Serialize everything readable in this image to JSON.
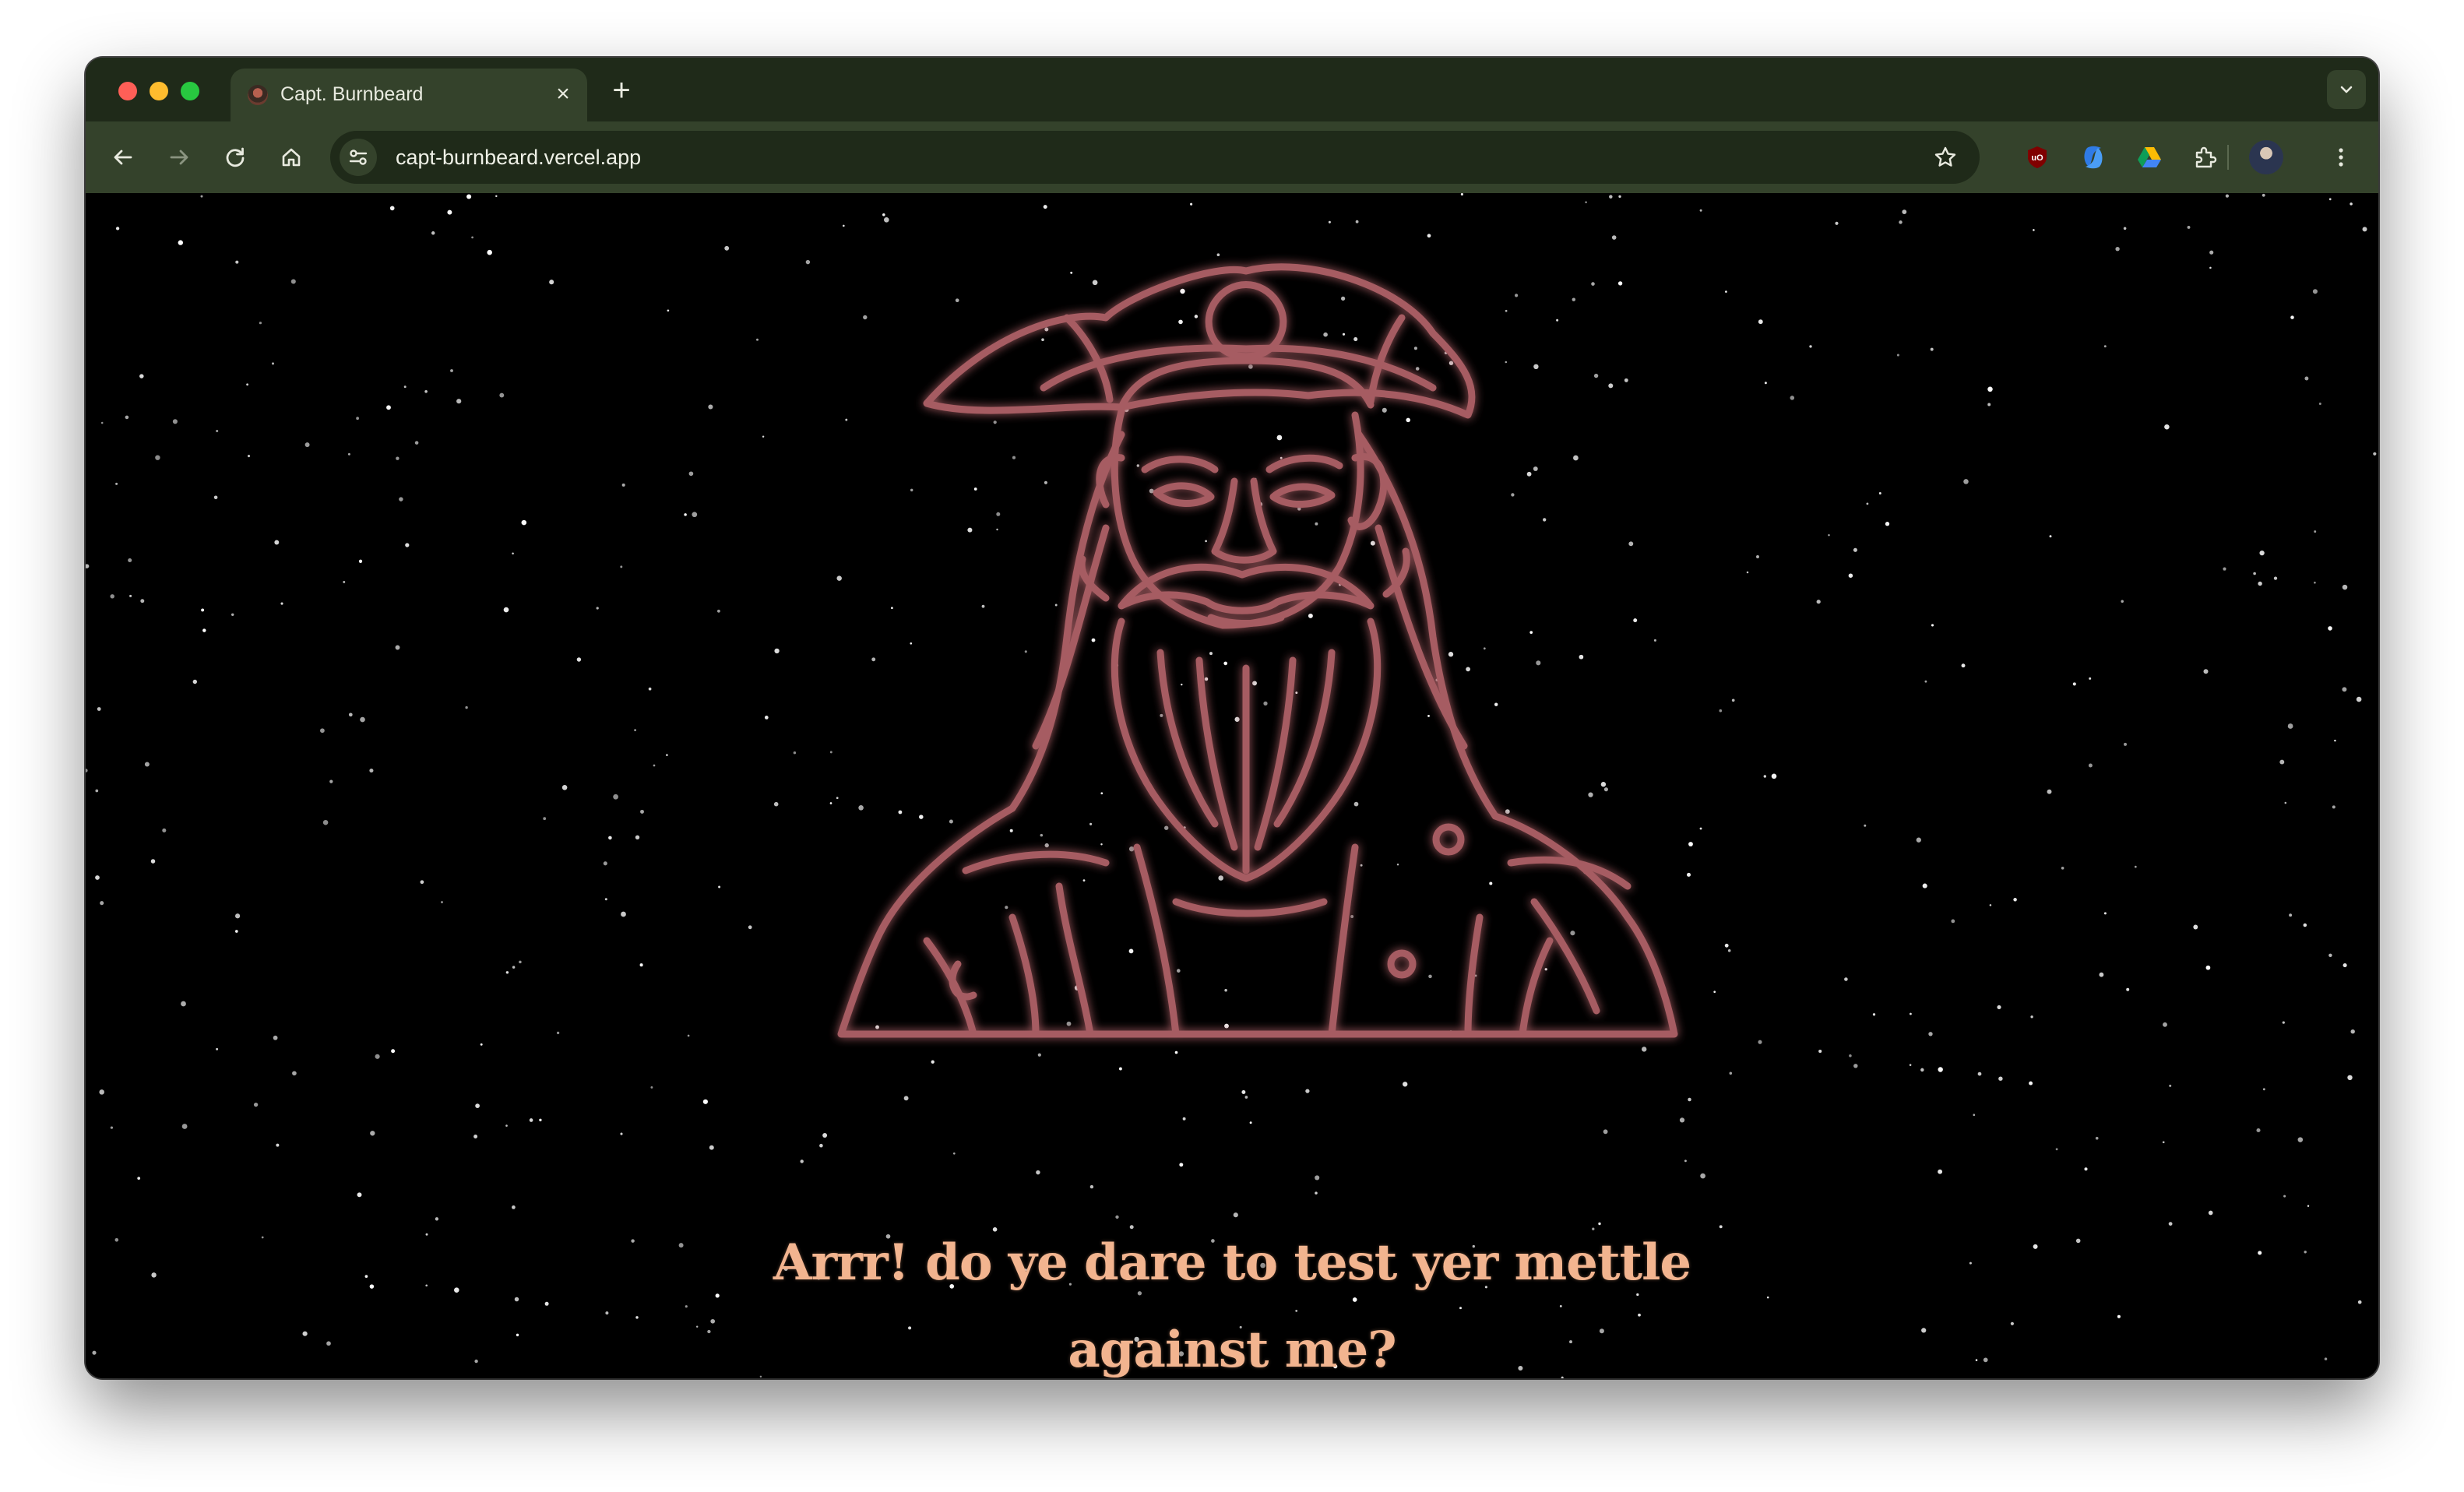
{
  "browser": {
    "tab": {
      "title": "Capt. Burnbeard",
      "favicon": "pirate-favicon-icon",
      "close": "×"
    },
    "new_tab": "+",
    "address_bar": {
      "url": "capt-burnbeard.vercel.app"
    },
    "extensions": [
      "ublock-origin-icon",
      "copilot-icon",
      "google-drive-icon",
      "extensions-puzzle-icon"
    ],
    "theme_colors": {
      "tabstrip": "#1f2a19",
      "toolbar": "#34422b",
      "omnibox": "#1f2a19"
    }
  },
  "page": {
    "background": "#000000",
    "hero_image": "pirate-captain-illustration",
    "glow_color": "#a65c62",
    "tagline": "Arrr! do ye dare to test yer mettle against me?",
    "tagline_color": "#f2b48f"
  }
}
